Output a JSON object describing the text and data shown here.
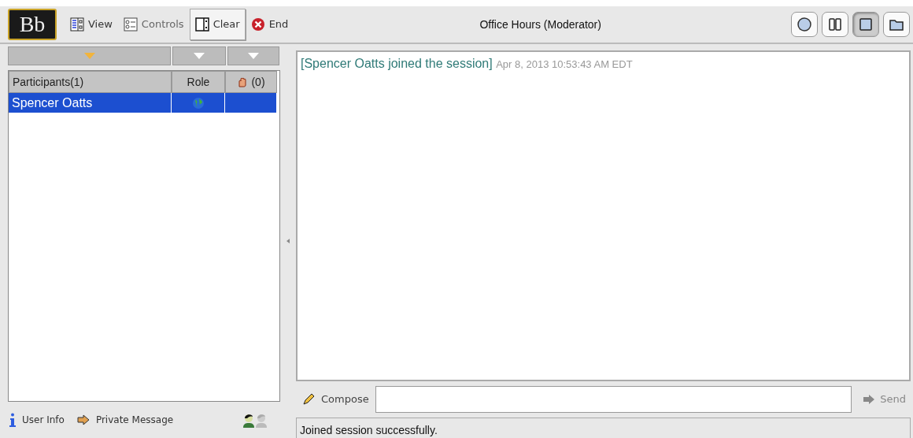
{
  "toolbar": {
    "logo": "Bb",
    "buttons": [
      {
        "label": "View",
        "kind": "view",
        "disabled": false,
        "pressed": false
      },
      {
        "label": "Controls",
        "kind": "controls",
        "disabled": true,
        "pressed": false
      },
      {
        "label": "Clear",
        "kind": "clear",
        "disabled": false,
        "pressed": true
      },
      {
        "label": "End",
        "kind": "end",
        "disabled": false,
        "pressed": false
      }
    ],
    "title": "Office Hours (Moderator)",
    "layout_buttons": [
      {
        "kind": "circle",
        "selected": false
      },
      {
        "kind": "columns",
        "selected": false
      },
      {
        "kind": "square",
        "selected": true
      },
      {
        "kind": "folder",
        "selected": false
      }
    ]
  },
  "participants": {
    "columns": [
      {
        "label": "Participants(1)",
        "kind": "text"
      },
      {
        "label": "Role",
        "kind": "text"
      },
      {
        "label": "(0)",
        "kind": "hand"
      }
    ],
    "rows": [
      {
        "name": "Spencer Oatts",
        "selected": true
      }
    ]
  },
  "bottom_bar": {
    "user_info": "User Info",
    "private_message": "Private Message",
    "people": [
      {
        "disabled": false
      },
      {
        "disabled": true
      }
    ]
  },
  "chat": {
    "messages": [
      {
        "text": "[Spencer Oatts joined the session]",
        "time": "Apr 8, 2013 10:53:43 AM EDT"
      }
    ],
    "compose": {
      "label": "Compose",
      "send": "Send",
      "send_disabled": true
    }
  },
  "status_bar": "Joined session successfully."
}
